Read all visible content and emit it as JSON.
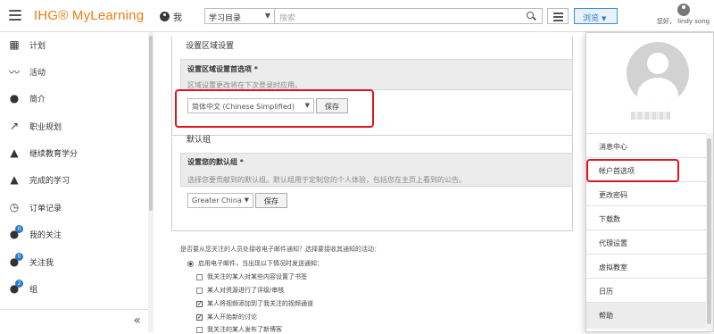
{
  "header": {
    "logo": "IHG® MyLearning",
    "me_label": "我",
    "catalog_select": "学习目录",
    "search_placeholder": "搜索",
    "browse_label": "浏览",
    "account_greeting": "您好， lindy song"
  },
  "sidebar": {
    "items": [
      {
        "label": "计划",
        "icon": "dashboard-icon"
      },
      {
        "label": "活动",
        "icon": "activity-line-icon"
      },
      {
        "label": "简介",
        "icon": "profile-icon"
      },
      {
        "label": "职业规划",
        "icon": "career-trend-icon"
      },
      {
        "label": "继续教育学分",
        "icon": "graduation-cap-icon"
      },
      {
        "label": "完成的学习",
        "icon": "graduation-check-icon"
      },
      {
        "label": "订单记录",
        "icon": "history-icon"
      },
      {
        "label": "我的关注",
        "icon": "following-icon",
        "badge": "0"
      },
      {
        "label": "关注我",
        "icon": "followers-icon",
        "badge": "0"
      },
      {
        "label": "组",
        "icon": "group-icon",
        "badge": "2"
      }
    ],
    "collapse_glyph": "«"
  },
  "settings": {
    "region_title": "设置区域设置",
    "region_heading": "设置区域设置首选项 *",
    "region_note": "区域设置更改将在下次登录时应用。",
    "locale_value": "简体中文 (Chinese Simplified)",
    "save_label": "保存",
    "group_title": "默认组",
    "group_heading": "设置您的默认组 *",
    "group_note": "选择您要贡献到的默认组。默认组用于定制您的个人体验，包括您在主页上看到的公告。",
    "group_value": "Greater China",
    "group_save_label": "保存"
  },
  "notifications": {
    "question": "是否要从您关注的人员处接收电子邮件通知？选择要接收其通知的活动：",
    "radio_label": "启用电子邮件，当出现以下情况时发送通知：",
    "options": [
      {
        "label": "我关注的某人对某些内容设置了书签",
        "checked": false
      },
      {
        "label": "某人对资源进行了评级/审核",
        "checked": false
      },
      {
        "label": "某人将视频添加到了我关注的视频通道",
        "checked": true
      },
      {
        "label": "某人开始新的讨论",
        "checked": true
      },
      {
        "label": "我关注的某人发布了新博客",
        "checked": false
      }
    ]
  },
  "account_menu": {
    "items": [
      {
        "label": "消息中心"
      },
      {
        "label": "帐户首选项"
      },
      {
        "label": "更改密码"
      },
      {
        "label": "下载数"
      },
      {
        "label": "代理设置"
      },
      {
        "label": "虚拟教室"
      },
      {
        "label": "日历"
      },
      {
        "label": "帮助"
      }
    ]
  },
  "colors": {
    "brand_orange": "#f07b14",
    "highlight_red": "#e0141e",
    "link_blue": "#2a78c5"
  }
}
